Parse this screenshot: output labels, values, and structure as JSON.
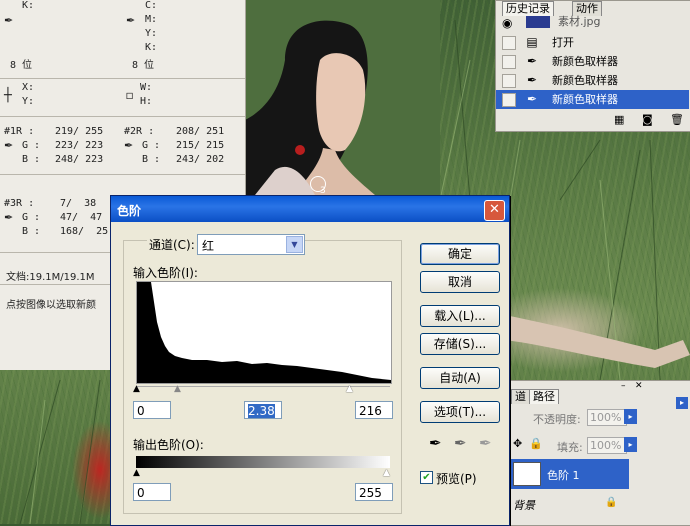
{
  "info_panel": {
    "k_label": "K:",
    "c_label": "C:",
    "m_label": "M:",
    "y_label": "Y:",
    "k2_label": "K:",
    "bits_left": "8 位",
    "bits_right": "8 位",
    "x_label": "X:",
    "y_coord_label": "Y:",
    "w_label": "W:",
    "h_label": "H:",
    "s1": {
      "r": "#1R :",
      "g": "G :",
      "b": "B :",
      "r_val": "219/ 255",
      "g_val": "223/ 223",
      "b_val": "248/ 223"
    },
    "s2": {
      "r": "#2R :",
      "g": "G :",
      "b": "B :",
      "r_val": "208/ 251",
      "g_val": "215/ 215",
      "b_val": "243/ 202"
    },
    "s3": {
      "r": "#3R :",
      "g": "G :",
      "b": "B :",
      "r_val": "7/  38",
      "g_val": "47/  47",
      "b_val": "168/  25"
    },
    "doc_size": "文档:19.1M/19.1M",
    "hint": "点按图像以选取新颜"
  },
  "history_panel": {
    "tab_history": "历史记录",
    "tab_actions": "动作",
    "top_item": "素材.jpg",
    "items": [
      {
        "label": "打开",
        "icon": "document-icon"
      },
      {
        "label": "新颜色取样器",
        "icon": "color-sampler-icon"
      },
      {
        "label": "新颜色取样器",
        "icon": "color-sampler-icon"
      },
      {
        "label": "新颜色取样器",
        "icon": "color-sampler-icon"
      }
    ]
  },
  "layers_panel": {
    "tab_channels": "道",
    "tab_paths": "路径",
    "opacity_label": "不透明度:",
    "opacity_value": "100%",
    "fill_label": "填充:",
    "fill_value": "100%",
    "layer_levels": "色阶 1",
    "layer_bg": "背景"
  },
  "sampler_marker": "3",
  "dialog": {
    "title": "色阶",
    "close": "✕",
    "channel_label": "通道(C):",
    "channel_value": "红",
    "input_levels_label": "输入色阶(I):",
    "input_black": "0",
    "input_gamma": "2.38",
    "input_white": "216",
    "output_levels_label": "输出色阶(O):",
    "output_black": "0",
    "output_white": "255",
    "btn_ok": "确定",
    "btn_cancel": "取消",
    "btn_load": "载入(L)...",
    "btn_save": "存储(S)...",
    "btn_auto": "自动(A)",
    "btn_options": "选项(T)...",
    "preview_label": "预览(P)",
    "preview_checked": true
  }
}
